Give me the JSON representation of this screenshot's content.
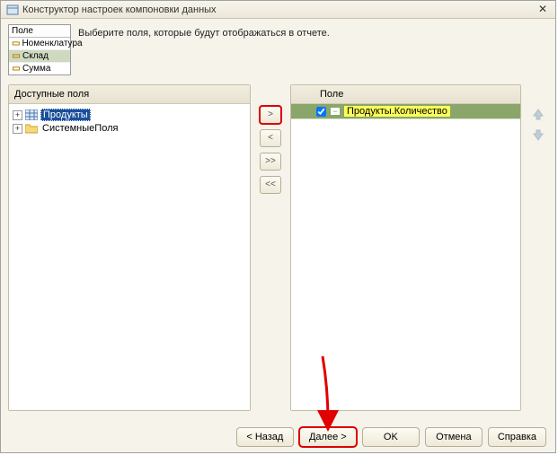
{
  "window": {
    "title": "Конструктор настроек компоновки данных"
  },
  "field_box": {
    "header": "Поле",
    "rows": [
      "Номенклатура",
      "Склад",
      "Сумма"
    ],
    "selected_index": 1
  },
  "instruction": "Выберите поля, которые будут отображаться в отчете.",
  "left_panel": {
    "header": "Доступные поля",
    "items": [
      {
        "label": "Продукты",
        "icon": "table-icon",
        "selected": true
      },
      {
        "label": "СистемныеПоля",
        "icon": "folder-icon",
        "selected": false
      }
    ]
  },
  "mid_buttons": {
    "add": ">",
    "add_all": ">>",
    "remove": "<",
    "remove_all": "<<"
  },
  "right_panel": {
    "header": "Поле",
    "row_label": "Продукты.Количество"
  },
  "footer": {
    "back": "< Назад",
    "next": "Далее >",
    "ok": "OK",
    "cancel": "Отмена",
    "help": "Справка"
  }
}
